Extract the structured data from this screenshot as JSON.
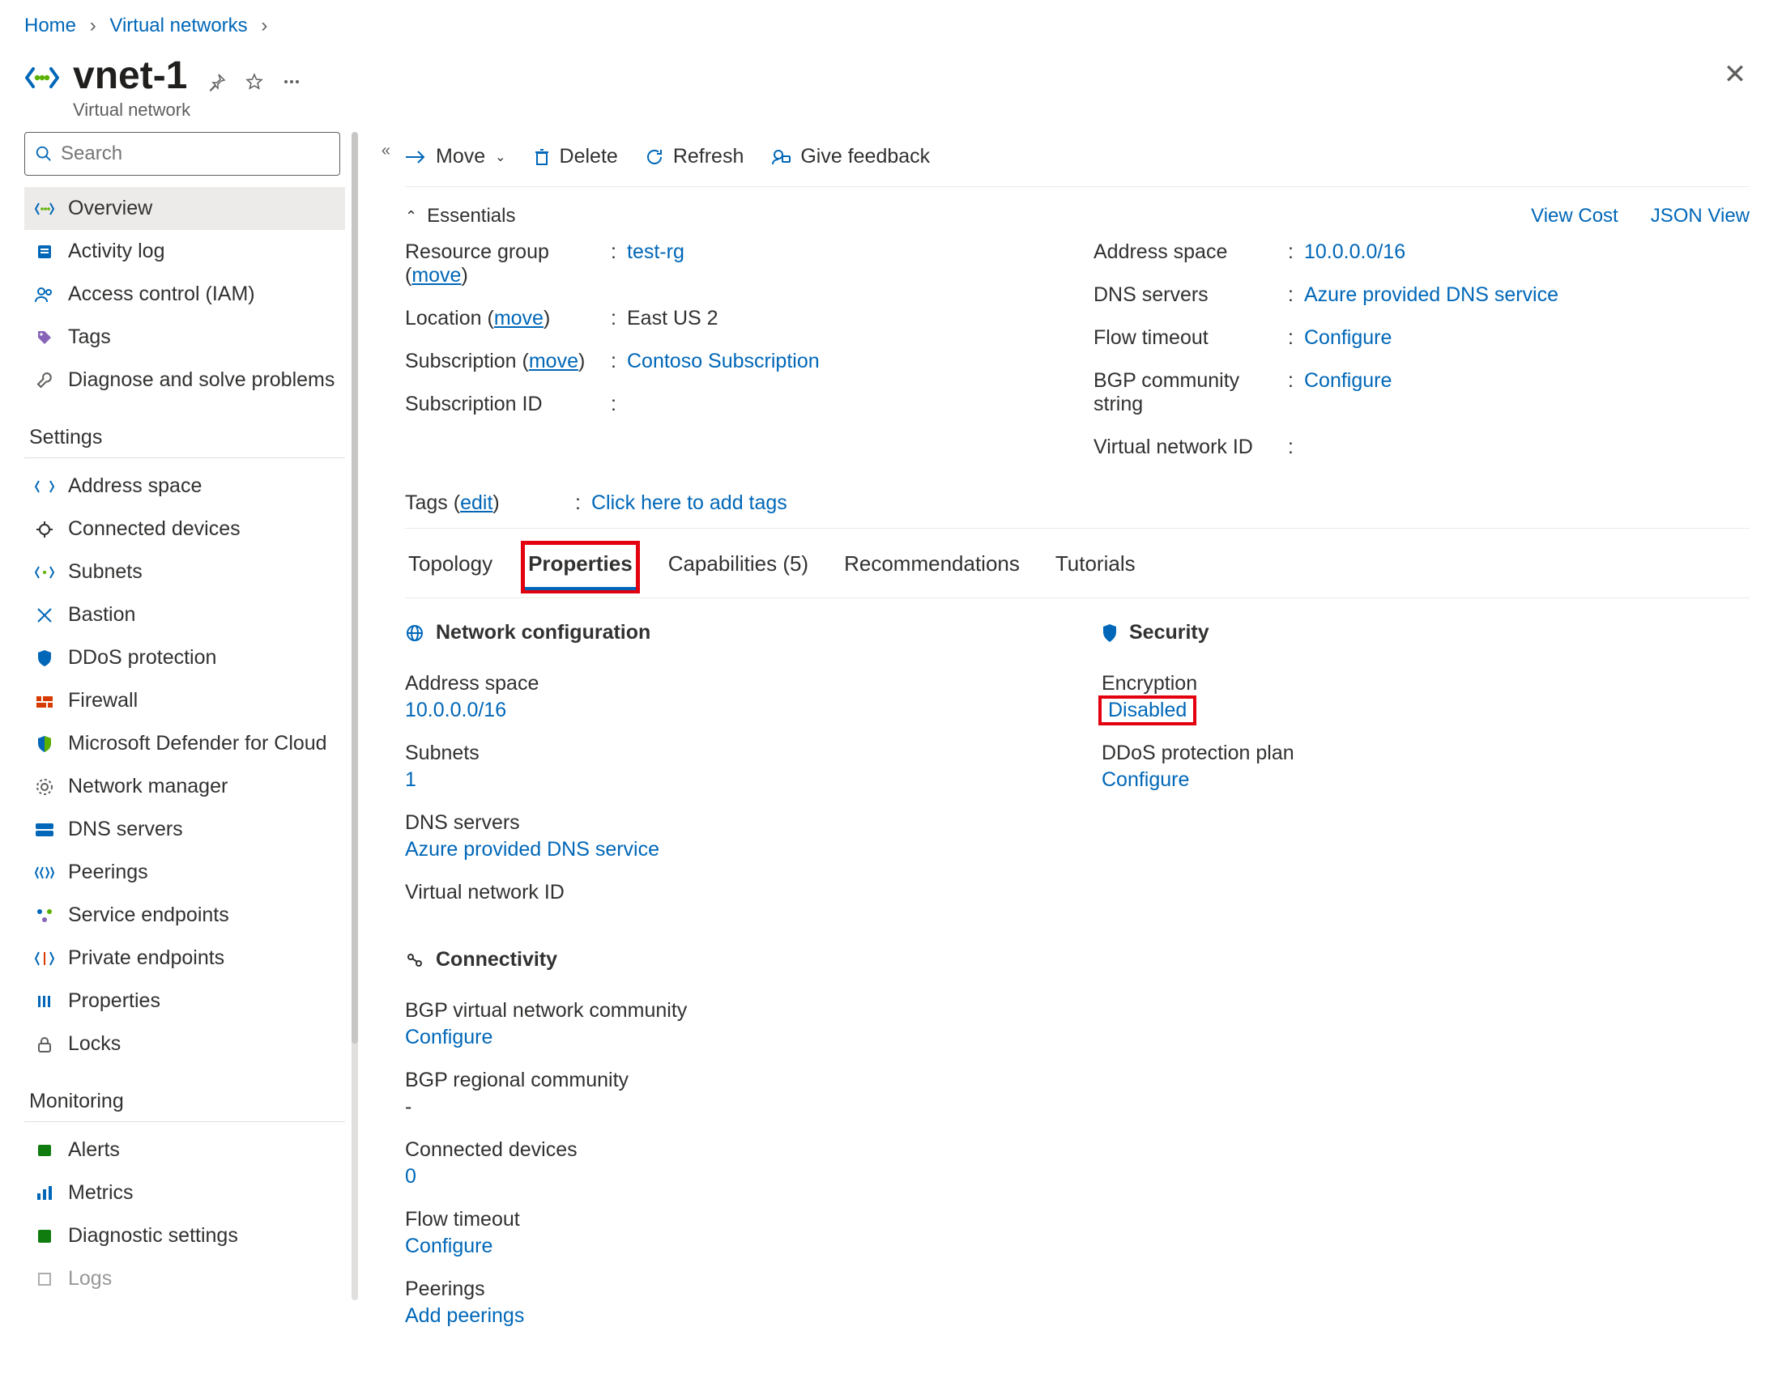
{
  "breadcrumb": {
    "home": "Home",
    "vnets": "Virtual networks"
  },
  "title": {
    "name": "vnet-1",
    "subtitle": "Virtual network"
  },
  "search": {
    "placeholder": "Search"
  },
  "sidebar": {
    "items": [
      {
        "label": "Overview"
      },
      {
        "label": "Activity log"
      },
      {
        "label": "Access control (IAM)"
      },
      {
        "label": "Tags"
      },
      {
        "label": "Diagnose and solve problems"
      }
    ],
    "settings_header": "Settings",
    "settings": [
      {
        "label": "Address space"
      },
      {
        "label": "Connected devices"
      },
      {
        "label": "Subnets"
      },
      {
        "label": "Bastion"
      },
      {
        "label": "DDoS protection"
      },
      {
        "label": "Firewall"
      },
      {
        "label": "Microsoft Defender for Cloud"
      },
      {
        "label": "Network manager"
      },
      {
        "label": "DNS servers"
      },
      {
        "label": "Peerings"
      },
      {
        "label": "Service endpoints"
      },
      {
        "label": "Private endpoints"
      },
      {
        "label": "Properties"
      },
      {
        "label": "Locks"
      }
    ],
    "monitoring_header": "Monitoring",
    "monitoring": [
      {
        "label": "Alerts"
      },
      {
        "label": "Metrics"
      },
      {
        "label": "Diagnostic settings"
      },
      {
        "label": "Logs"
      }
    ]
  },
  "cmdbar": {
    "move": "Move",
    "delete": "Delete",
    "refresh": "Refresh",
    "feedback": "Give feedback"
  },
  "essentials": {
    "header": "Essentials",
    "viewcost": "View Cost",
    "jsonview": "JSON View",
    "left": [
      {
        "label": "Resource group",
        "move": "move",
        "value": "test-rg",
        "link": true
      },
      {
        "label": "Location",
        "move": "move",
        "value": "East US 2"
      },
      {
        "label": "Subscription",
        "move": "move",
        "value": "Contoso Subscription",
        "link": true
      },
      {
        "label": "Subscription ID",
        "value": ""
      }
    ],
    "right": [
      {
        "label": "Address space",
        "value": "10.0.0.0/16",
        "link": true
      },
      {
        "label": "DNS servers",
        "value": "Azure provided DNS service",
        "link": true
      },
      {
        "label": "Flow timeout",
        "value": "Configure",
        "link": true
      },
      {
        "label": "BGP community string",
        "value": "Configure",
        "link": true
      },
      {
        "label": "Virtual network ID",
        "value": ""
      }
    ],
    "tags": {
      "label": "Tags",
      "edit": "edit",
      "value": "Click here to add tags"
    }
  },
  "tabs": {
    "topology": "Topology",
    "properties": "Properties",
    "capabilities": "Capabilities (5)",
    "recommendations": "Recommendations",
    "tutorials": "Tutorials"
  },
  "properties": {
    "netcfg": {
      "heading": "Network configuration",
      "addr_label": "Address space",
      "addr_value": "10.0.0.0/16",
      "subnets_label": "Subnets",
      "subnets_value": "1",
      "dns_label": "DNS servers",
      "dns_value": "Azure provided DNS service",
      "vnetid_label": "Virtual network ID"
    },
    "security": {
      "heading": "Security",
      "enc_label": "Encryption",
      "enc_value": "Disabled",
      "ddos_label": "DDoS protection plan",
      "ddos_value": "Configure"
    },
    "connectivity": {
      "heading": "Connectivity",
      "bgpvn_label": "BGP virtual network community",
      "bgpvn_value": "Configure",
      "bgpr_label": "BGP regional community",
      "bgpr_value": "-",
      "conn_label": "Connected devices",
      "conn_value": "0",
      "flow_label": "Flow timeout",
      "flow_value": "Configure",
      "peer_label": "Peerings",
      "peer_value": "Add peerings"
    }
  }
}
